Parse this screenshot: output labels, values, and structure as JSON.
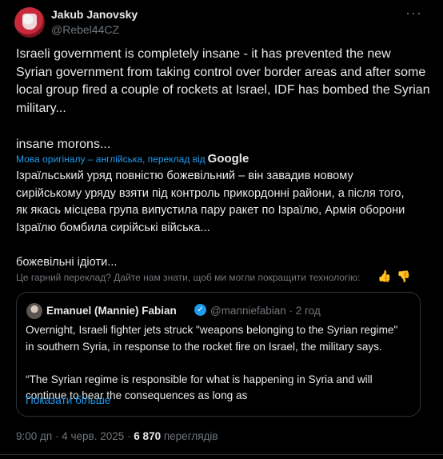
{
  "author": {
    "name": "Jakub Janovsky",
    "handle": "@Rebel44CZ"
  },
  "more_label": "···",
  "tweet": {
    "text": "Israeli government is completely insane - it has prevented the new\nSyrian government from taking control over border areas and after some\nlocal group fired a couple of rockets at Israel, IDF has bombed the Syrian\nmilitary...\n\ninsane morons..."
  },
  "translation": {
    "source_label": "Мова оригіналу – англійська, переклад від",
    "provider": "Google",
    "text": "Ізраїльський уряд повністю божевільний – він завадив новому\nсирійському уряду взяти під контроль прикордонні райони, а після того,\nяк якась місцева група випустила пару ракет по Ізраїлю, Армія оборони\nІзраїлю бомбила сирійські війська...\n\nбожевільні ідіоти...",
    "feedback_prompt": "Це гарний переклад? Дайте нам знати, щоб ми могли покращити технологію:",
    "thumb_up": "👍",
    "thumb_down": "👍"
  },
  "quote": {
    "name": "Emanuel (Mannie) Fabian",
    "verified": "✓",
    "handle": "@manniefabian",
    "separator": "·",
    "time": "2 год",
    "text": "Overnight, Israeli fighter jets struck \"weapons belonging to the Syrian regime\"\nin southern Syria, in response to the rocket fire on Israel, the military says.\n\n“The Syrian regime is responsible for what is happening in Syria and will\ncontinue to bear the consequences as long as",
    "show_more": "Показати більше"
  },
  "footer": {
    "time": "9:00 дп",
    "dot1": "·",
    "date": "4 черв. 2025",
    "dot2": "·",
    "views_count": "6 870",
    "views_label": "переглядів"
  },
  "colors": {
    "background": "#000000",
    "text": "#e7e9ea",
    "muted": "#71767b",
    "link": "#1d9bf0",
    "border": "#2f3336"
  }
}
